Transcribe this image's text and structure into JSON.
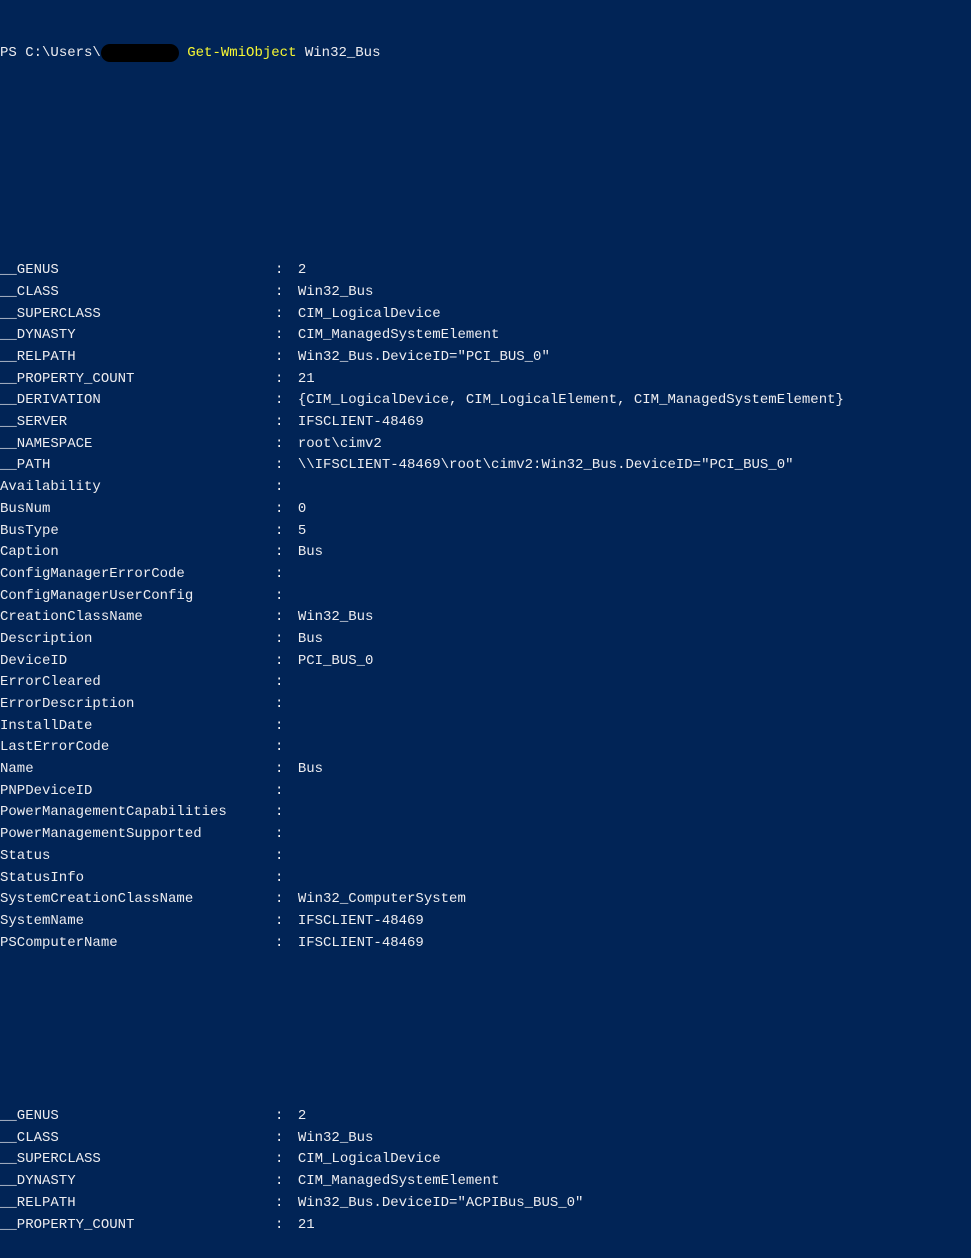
{
  "prompt": {
    "ps": "PS ",
    "path_prefix": "C:\\Users\\",
    "path_suffix": " ",
    "cmdlet": "Get-WmiObject",
    "arg": " Win32_Bus"
  },
  "sep": ":",
  "block1": [
    {
      "name": "__GENUS",
      "value": "2"
    },
    {
      "name": "__CLASS",
      "value": "Win32_Bus"
    },
    {
      "name": "__SUPERCLASS",
      "value": "CIM_LogicalDevice"
    },
    {
      "name": "__DYNASTY",
      "value": "CIM_ManagedSystemElement"
    },
    {
      "name": "__RELPATH",
      "value": "Win32_Bus.DeviceID=\"PCI_BUS_0\""
    },
    {
      "name": "__PROPERTY_COUNT",
      "value": "21"
    },
    {
      "name": "__DERIVATION",
      "value": "{CIM_LogicalDevice, CIM_LogicalElement, CIM_ManagedSystemElement}"
    },
    {
      "name": "__SERVER",
      "value": "IFSCLIENT-48469"
    },
    {
      "name": "__NAMESPACE",
      "value": "root\\cimv2"
    },
    {
      "name": "__PATH",
      "value": "\\\\IFSCLIENT-48469\\root\\cimv2:Win32_Bus.DeviceID=\"PCI_BUS_0\""
    },
    {
      "name": "Availability",
      "value": ""
    },
    {
      "name": "BusNum",
      "value": "0"
    },
    {
      "name": "BusType",
      "value": "5"
    },
    {
      "name": "Caption",
      "value": "Bus"
    },
    {
      "name": "ConfigManagerErrorCode",
      "value": ""
    },
    {
      "name": "ConfigManagerUserConfig",
      "value": ""
    },
    {
      "name": "CreationClassName",
      "value": "Win32_Bus"
    },
    {
      "name": "Description",
      "value": "Bus"
    },
    {
      "name": "DeviceID",
      "value": "PCI_BUS_0"
    },
    {
      "name": "ErrorCleared",
      "value": ""
    },
    {
      "name": "ErrorDescription",
      "value": ""
    },
    {
      "name": "InstallDate",
      "value": ""
    },
    {
      "name": "LastErrorCode",
      "value": ""
    },
    {
      "name": "Name",
      "value": "Bus"
    },
    {
      "name": "PNPDeviceID",
      "value": ""
    },
    {
      "name": "PowerManagementCapabilities",
      "value": ""
    },
    {
      "name": "PowerManagementSupported",
      "value": ""
    },
    {
      "name": "Status",
      "value": ""
    },
    {
      "name": "StatusInfo",
      "value": ""
    },
    {
      "name": "SystemCreationClassName",
      "value": "Win32_ComputerSystem"
    },
    {
      "name": "SystemName",
      "value": "IFSCLIENT-48469"
    },
    {
      "name": "PSComputerName",
      "value": "IFSCLIENT-48469"
    }
  ],
  "block2": [
    {
      "name": "__GENUS",
      "value": "2"
    },
    {
      "name": "__CLASS",
      "value": "Win32_Bus"
    },
    {
      "name": "__SUPERCLASS",
      "value": "CIM_LogicalDevice"
    },
    {
      "name": "__DYNASTY",
      "value": "CIM_ManagedSystemElement"
    },
    {
      "name": "__RELPATH",
      "value": "Win32_Bus.DeviceID=\"ACPIBus_BUS_0\""
    },
    {
      "name": "__PROPERTY_COUNT",
      "value": "21"
    }
  ]
}
